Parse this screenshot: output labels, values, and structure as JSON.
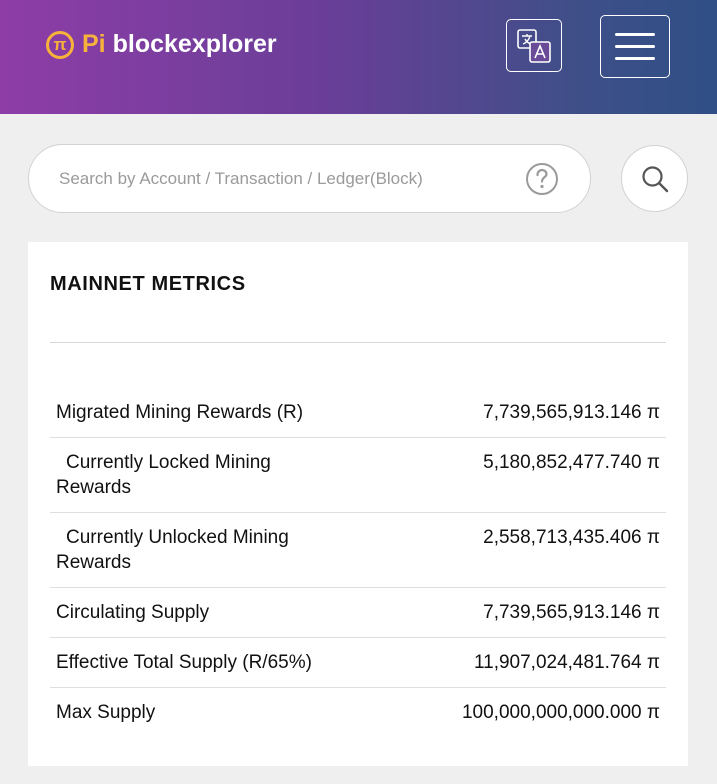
{
  "header": {
    "logo_symbol": "π",
    "logo_pi": "Pi",
    "logo_text": "blockexplorer",
    "brand_color": "#f6b23a",
    "gradient_start": "#8e3da7",
    "gradient_end": "#2f4f86",
    "language_icon": "translate-icon",
    "menu_icon": "hamburger-menu-icon"
  },
  "search": {
    "placeholder": "Search by Account / Transaction / Ledger(Block)",
    "value": "",
    "help_icon": "question-circle-icon",
    "search_icon": "magnifier-icon"
  },
  "metrics": {
    "title": "MAINNET METRICS",
    "rows": [
      {
        "label": "Migrated Mining Rewards (R)",
        "value": "7,739,565,913.146 π"
      },
      {
        "label": "Currently Locked Mining Rewards",
        "value": "5,180,852,477.740 π"
      },
      {
        "label": "Currently Unlocked Mining Rewards",
        "value": "2,558,713,435.406 π"
      },
      {
        "label": "Circulating Supply",
        "value": "7,739,565,913.146 π"
      },
      {
        "label": "Effective Total Supply (R/65%)",
        "value": "11,907,024,481.764 π"
      },
      {
        "label": "Max Supply",
        "value": "100,000,000,000.000 π"
      }
    ]
  }
}
